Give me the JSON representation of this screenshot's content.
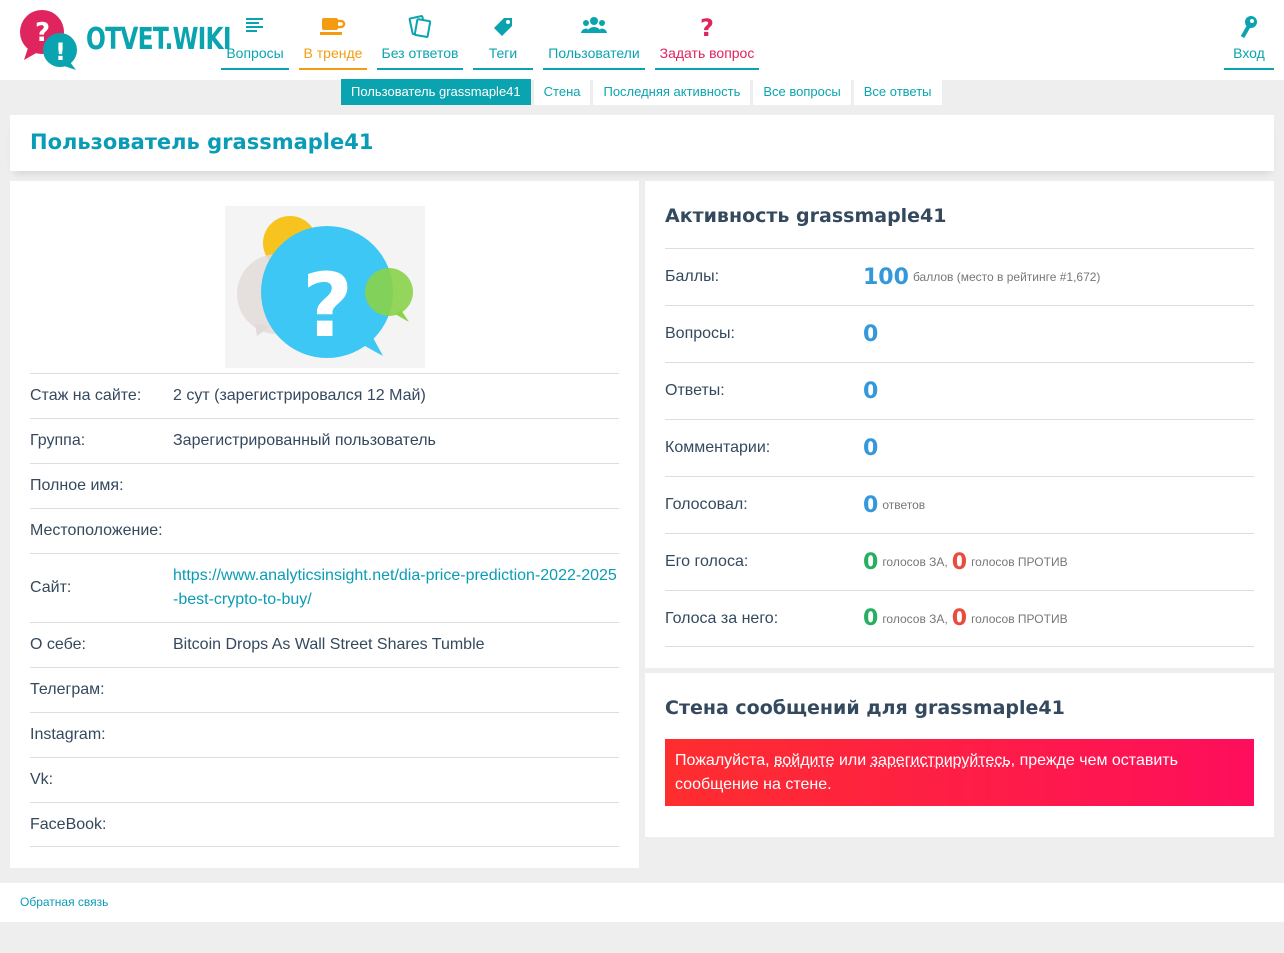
{
  "header": {
    "logo_text": "OTVET",
    "logo_dot": ".",
    "logo_suffix": "WIKI",
    "nav": [
      {
        "label": "Вопросы",
        "icon": "list-icon"
      },
      {
        "label": "В тренде",
        "icon": "coffee-cup-icon"
      },
      {
        "label": "Без ответов",
        "icon": "cards-icon"
      },
      {
        "label": "Теги",
        "icon": "tag-icon"
      },
      {
        "label": "Пользователи",
        "icon": "users-icon"
      },
      {
        "label": "Задать вопрос",
        "icon": "question-mark-icon"
      }
    ],
    "login": {
      "label": "Вход",
      "icon": "key-icon"
    },
    "colors": {
      "accent": "#0aa4b0",
      "trend": "#f39c12",
      "ask": "#e0245e"
    }
  },
  "subtabs": [
    {
      "label": "Пользователь grassmaple41",
      "active": true
    },
    {
      "label": "Стена",
      "active": false
    },
    {
      "label": "Последняя активность",
      "active": false
    },
    {
      "label": "Все вопросы",
      "active": false
    },
    {
      "label": "Все ответы",
      "active": false
    }
  ],
  "page_title": "Пользователь grassmaple41",
  "profile": {
    "rows": [
      {
        "key": "Стаж на сайте:",
        "value": "2 сут (зарегистрировался 12 Май)"
      },
      {
        "key": "Группа:",
        "value": "Зарегистрированный пользователь"
      },
      {
        "key": "Полное имя:",
        "value": ""
      },
      {
        "key": "Местоположение:",
        "value": ""
      },
      {
        "key": "Сайт:",
        "value": "https://www.analyticsinsight.net/dia-price-prediction-2022-2025-best-crypto-to-buy/"
      },
      {
        "key": "О себе:",
        "value": "Bitcoin Drops As Wall Street Shares Tumble"
      },
      {
        "key": "Телеграм:",
        "value": ""
      },
      {
        "key": "Instagram:",
        "value": ""
      },
      {
        "key": "Vk:",
        "value": ""
      },
      {
        "key": "FaceBook:",
        "value": ""
      }
    ]
  },
  "activity": {
    "title": "Активность grassmaple41",
    "points": {
      "label": "Баллы:",
      "value": "100",
      "suffix": "баллов (место в рейтинге #1,672)"
    },
    "questions": {
      "label": "Вопросы:",
      "value": "0"
    },
    "answers": {
      "label": "Ответы:",
      "value": "0"
    },
    "comments": {
      "label": "Комментарии:",
      "value": "0"
    },
    "voted": {
      "label": "Голосовал:",
      "value": "0",
      "suffix": "ответов"
    },
    "his_votes": {
      "label": "Его голоса:",
      "up": "0",
      "up_suffix": "голосов ЗА,",
      "down": "0",
      "down_suffix": "голосов ПРОТИВ"
    },
    "votes_for_him": {
      "label": "Голоса за него:",
      "up": "0",
      "up_suffix": "голосов ЗА,",
      "down": "0",
      "down_suffix": "голосов ПРОТИВ"
    }
  },
  "wall": {
    "title": "Стена сообщений для grassmaple41",
    "alert_prefix": "Пожалуйста,",
    "login_link": "войдите",
    "alert_or": "или",
    "register_link": "зарегистрируйтесь",
    "alert_suffix": ", прежде чем оставить сообщение на стене."
  },
  "footer": {
    "feedback": "Обратная связь"
  }
}
